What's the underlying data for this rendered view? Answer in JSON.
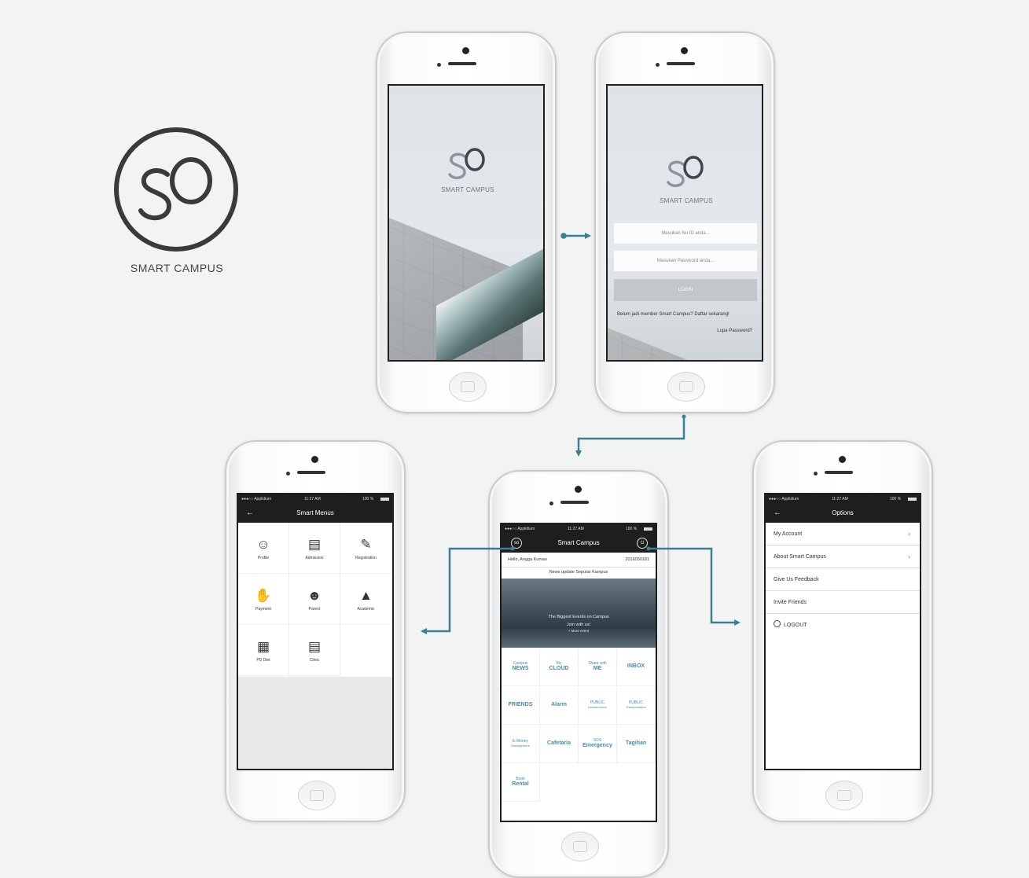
{
  "brand": {
    "name": "SMART CAMPUS",
    "logo_mark": "SO"
  },
  "colors": {
    "accent": "#4a8aa0",
    "connector": "#3d7e95",
    "bar": "#1e1e1e"
  },
  "splash": {
    "app_name": "SMART CAMPUS"
  },
  "login": {
    "app_name": "SMART CAMPUS",
    "id_placeholder": "Masukan No ID anda...",
    "password_placeholder": "Masukan Password anda...",
    "login_button": "LOGIN",
    "register_link": "Belum jadi member Smart Campus? Daftar sekarang!",
    "forgot_link": "Lupa Password?"
  },
  "status": {
    "carrier": "●●●○○ Applidium",
    "time": "11:27 AM",
    "battery": "100 %"
  },
  "menus": {
    "title": "Smart Menus",
    "items": [
      {
        "label": "Profile",
        "icon": "profile-icon"
      },
      {
        "label": "Admission",
        "icon": "admission-icon"
      },
      {
        "label": "Registration",
        "icon": "registration-icon"
      },
      {
        "label": "Payment",
        "icon": "payment-icon"
      },
      {
        "label": "Parent",
        "icon": "parent-icon"
      },
      {
        "label": "Academic",
        "icon": "graduation-cap-icon"
      },
      {
        "label": "PD Diet",
        "icon": "pd-icon"
      },
      {
        "label": "Clinic",
        "icon": "clinic-icon"
      }
    ]
  },
  "home": {
    "title": "Smart Campus",
    "greeting": "Hello, Angga Kuniao",
    "student_id": "2016050181",
    "news_title": "News update Seputar Kampus",
    "banner_line1": "The Biggest Events on Campus",
    "banner_line2": "Join with us!",
    "banner_line3": "+ More event",
    "tiles": [
      [
        "Campus",
        "NEWS"
      ],
      [
        "My",
        "CLOUD"
      ],
      [
        "Share with",
        "ME"
      ],
      [
        "",
        "INBOX"
      ],
      [
        "",
        "FRIENDS"
      ],
      [
        "",
        "Alarm"
      ],
      [
        "PUBLIC",
        "Infrastructure"
      ],
      [
        "PUBLIC",
        "Transportation"
      ],
      [
        "E-Money",
        "Management"
      ],
      [
        "",
        "Cafetaria"
      ],
      [
        "SOS",
        "Emergency"
      ],
      [
        "",
        "Tagihan"
      ],
      [
        "Book",
        "Rental"
      ]
    ]
  },
  "options": {
    "title": "Options",
    "items": [
      "My Account",
      "About Smart Campus",
      "Give Us Feedback",
      "Invite Friends"
    ],
    "logout": "LOGOUT"
  }
}
